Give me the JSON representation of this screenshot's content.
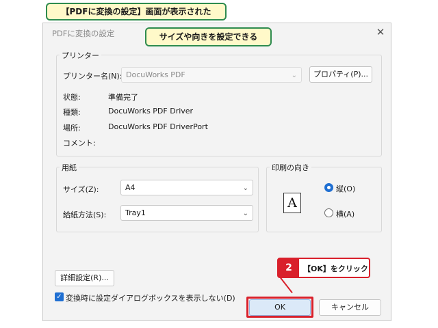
{
  "callouts": {
    "top": "【PDFに変換の設定】画面が表示された",
    "middle": "サイズや向きを設定できる",
    "step_number": "2",
    "step_text": "【OK】をクリック"
  },
  "dialog": {
    "title": "PDFに変換の設定",
    "close_icon": "close-icon"
  },
  "printer_group": {
    "legend": "プリンター",
    "printer_name_label": "プリンター名(N):",
    "printer_name_value": "DocuWorks PDF",
    "properties_button": "プロパティ(P)...",
    "status_label": "状態:",
    "status_value": "準備完了",
    "type_label": "種類:",
    "type_value": "DocuWorks PDF Driver",
    "location_label": "場所:",
    "location_value": "DocuWorks PDF DriverPort",
    "comment_label": "コメント:"
  },
  "paper_group": {
    "legend": "用紙",
    "size_label": "サイズ(Z):",
    "size_value": "A4",
    "source_label": "給紙方法(S):",
    "source_value": "Tray1"
  },
  "orientation_group": {
    "legend": "印刷の向き",
    "portrait_label": "縦(O)",
    "landscape_label": "横(A)",
    "selected": "portrait",
    "preview_glyph": "A"
  },
  "footer": {
    "advanced_button": "詳細設定(R)...",
    "checkbox_label": "変換時に設定ダイアログボックスを表示しない(D)",
    "checkbox_checked": true,
    "ok_button": "OK",
    "cancel_button": "キャンセル"
  },
  "colors": {
    "accent": "#1f6fd2",
    "callout_border": "#2e8b4e",
    "callout_fill": "#fff9c9",
    "step_red": "#d9202b"
  }
}
